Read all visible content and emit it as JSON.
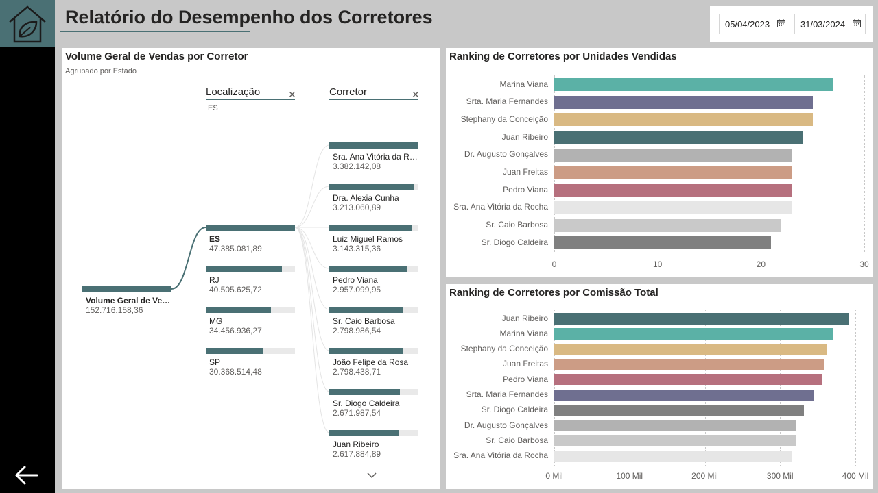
{
  "page": {
    "title": "Relatório do Desempenho dos Corretores",
    "start_date": "05/04/2023",
    "end_date": "31/03/2024",
    "icons": {
      "logo": "leaf-house-icon",
      "back": "arrow-left-icon",
      "calendar": "calendar-icon",
      "clear": "close-icon",
      "expand": "chevron-down-icon"
    }
  },
  "tree": {
    "title": "Volume Geral de Vendas por Corretor",
    "subtitle": "Agrupado por Estado",
    "root": {
      "label": "Volume Geral de Vendas",
      "value": "152.716.158,36",
      "fraction": 1.0
    },
    "level1": {
      "header": "Localização",
      "selected": "ES",
      "nodes": [
        {
          "label": "ES",
          "value": "47.385.081,89",
          "fraction": 1.0
        },
        {
          "label": "RJ",
          "value": "40.505.625,72",
          "fraction": 0.855
        },
        {
          "label": "MG",
          "value": "34.456.936,27",
          "fraction": 0.727
        },
        {
          "label": "SP",
          "value": "30.368.514,48",
          "fraction": 0.641
        }
      ]
    },
    "level2": {
      "header": "Corretor",
      "nodes": [
        {
          "label": "Sra. Ana Vitória da Rocha",
          "value": "3.382.142,08",
          "fraction": 1.0
        },
        {
          "label": "Dra. Alexia Cunha",
          "value": "3.213.060,89",
          "fraction": 0.95
        },
        {
          "label": "Luiz Miguel Ramos",
          "value": "3.143.315,36",
          "fraction": 0.929
        },
        {
          "label": "Pedro Viana",
          "value": "2.957.099,95",
          "fraction": 0.874
        },
        {
          "label": "Sr. Caio Barbosa",
          "value": "2.798.986,54",
          "fraction": 0.828
        },
        {
          "label": "João Felipe da Rosa",
          "value": "2.798.438,71",
          "fraction": 0.827
        },
        {
          "label": "Sr. Diogo Caldeira",
          "value": "2.671.987,54",
          "fraction": 0.79
        },
        {
          "label": "Juan Ribeiro",
          "value": "2.617.884,89",
          "fraction": 0.774
        }
      ]
    }
  },
  "chart_data": [
    {
      "type": "bar",
      "orientation": "horizontal",
      "title": "Ranking de Corretores por Unidades Vendidas",
      "categories": [
        "Marina Viana",
        "Srta. Maria Fernandes",
        "Stephany da Conceição",
        "Juan Ribeiro",
        "Dr. Augusto Gonçalves",
        "Juan Freitas",
        "Pedro Viana",
        "Sra. Ana Vitória da Rocha",
        "Sr. Caio Barbosa",
        "Sr. Diogo Caldeira"
      ],
      "values": [
        27,
        25,
        25,
        24,
        23,
        23,
        23,
        23,
        22,
        21
      ],
      "colors": [
        "#5bb1a6",
        "#6f6f90",
        "#d9b983",
        "#4a7074",
        "#b2b2b2",
        "#cc9c85",
        "#b6707e",
        "#e6e6e6",
        "#c9c9c9",
        "#808080"
      ],
      "xlim": [
        0,
        30
      ],
      "ticks": [
        0,
        10,
        20,
        30
      ],
      "tick_labels": [
        "0",
        "10",
        "20",
        "30"
      ],
      "grid": true
    },
    {
      "type": "bar",
      "orientation": "horizontal",
      "title": "Ranking de Corretores por Comissão Total",
      "categories": [
        "Juan Ribeiro",
        "Marina Viana",
        "Stephany da Conceição",
        "Juan Freitas",
        "Pedro Viana",
        "Srta. Maria Fernandes",
        "Sr. Diogo Caldeira",
        "Dr. Augusto Gonçalves",
        "Sr. Caio Barbosa",
        "Sra. Ana Vitória da Rocha"
      ],
      "values": [
        392,
        371,
        363,
        359,
        355,
        344,
        332,
        322,
        321,
        316
      ],
      "colors": [
        "#4a7074",
        "#5bb1a6",
        "#d9b983",
        "#cc9c85",
        "#b6707e",
        "#6f6f90",
        "#808080",
        "#b2b2b2",
        "#c9c9c9",
        "#e6e6e6"
      ],
      "xlim": [
        0,
        400
      ],
      "ticks": [
        0,
        100,
        200,
        300,
        400
      ],
      "tick_labels": [
        "0 Mil",
        "100 Mil",
        "200 Mil",
        "300 Mil",
        "400 Mil"
      ],
      "grid": true
    }
  ]
}
